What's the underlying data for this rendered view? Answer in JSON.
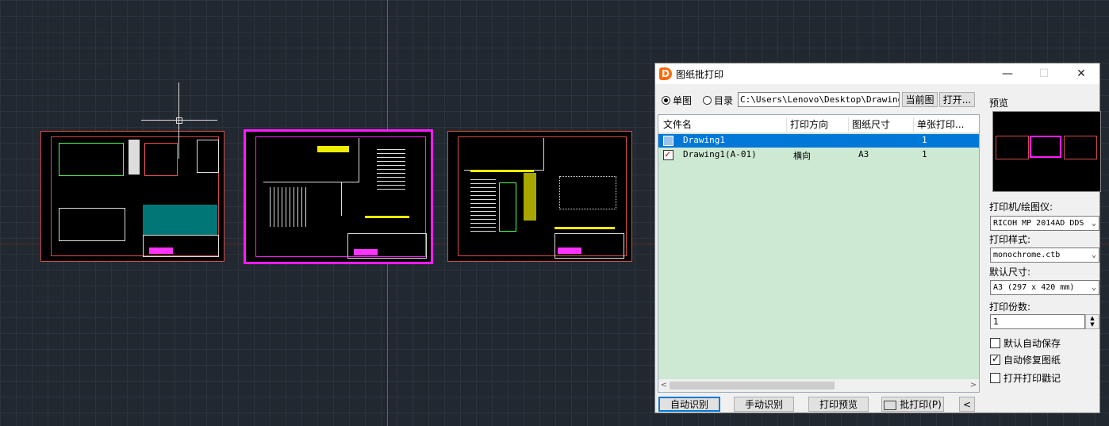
{
  "dialog": {
    "title": "图纸批打印",
    "window_buttons": {
      "minimize": "—",
      "maximize": "☐",
      "close": "✕"
    },
    "mode": {
      "single_label": "单图",
      "directory_label": "目录",
      "selected": "single",
      "path_value": "C:\\Users\\Lenovo\\Desktop\\Drawing1.",
      "current_button": "当前图",
      "open_button": "打开..."
    },
    "file_list": {
      "columns": [
        "文件名",
        "打印方向",
        "图纸尺寸",
        "单张打印..."
      ],
      "rows": [
        {
          "name": "Drawing1",
          "orientation": "",
          "size": "",
          "count": "1",
          "checked": false,
          "selected": true
        },
        {
          "name": "Drawing1(A-01)",
          "orientation": "横向",
          "size": "A3",
          "count": "1",
          "checked": true,
          "selected": false
        }
      ]
    },
    "right_panel": {
      "preview_label": "预览",
      "printer_label": "打印机/绘图仪:",
      "printer_value": "RICOH MP 2014AD DDS",
      "style_label": "打印样式:",
      "style_value": "monochrome.ctb",
      "size_label": "默认尺寸:",
      "size_value": "A3 (297 x 420 mm)",
      "copies_label": "打印份数:",
      "copies_value": "1",
      "auto_save_label": "默认自动保存",
      "auto_save_checked": false,
      "auto_repair_label": "自动修复图纸",
      "auto_repair_checked": true,
      "open_stamp_label": "打开打印戳记",
      "open_stamp_checked": false
    },
    "bottom_buttons": {
      "auto_detect": "自动识别",
      "manual_detect": "手动识别",
      "print_preview": "打印预览",
      "batch_print": "批打印(P)",
      "collapse": "<"
    }
  },
  "colors": {
    "canvas_bg": "#212830",
    "sheet_border": "#d44d4d",
    "selected_sheet": "#ff1bff",
    "list_bg": "#cde9d3",
    "selection": "#0078d7"
  }
}
